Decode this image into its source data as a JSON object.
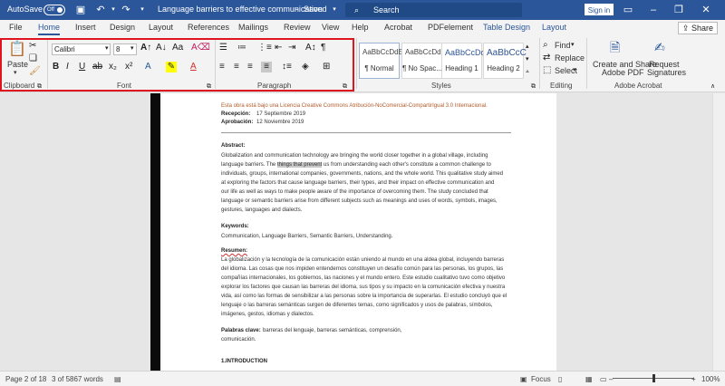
{
  "titlebar": {
    "autosave_label": "AutoSave",
    "autosave_state": "Off",
    "doc_title": "Language barriers to effective communication",
    "saved_state": "Saved",
    "search_placeholder": "Search",
    "signin_label": "Sign in",
    "brand_color": "#2b579a"
  },
  "tabs": [
    {
      "label": "File"
    },
    {
      "label": "Home",
      "active": true
    },
    {
      "label": "Insert"
    },
    {
      "label": "Design"
    },
    {
      "label": "Layout"
    },
    {
      "label": "References"
    },
    {
      "label": "Mailings"
    },
    {
      "label": "Review"
    },
    {
      "label": "View"
    },
    {
      "label": "Help"
    },
    {
      "label": "Acrobat"
    },
    {
      "label": "PDFelement"
    },
    {
      "label": "Table Design",
      "contextual": true
    },
    {
      "label": "Layout",
      "contextual": true
    }
  ],
  "share_label": "Share",
  "ribbon": {
    "clipboard": {
      "paste_label": "Paste",
      "group_label": "Clipboard"
    },
    "font": {
      "font_name": "Calibri",
      "font_size": "8",
      "group_label": "Font"
    },
    "paragraph": {
      "group_label": "Paragraph"
    },
    "styles": {
      "group_label": "Styles",
      "items": [
        {
          "sample": "AaBbCcDdEe",
          "name": "¶ Normal"
        },
        {
          "sample": "AaBbCcDdEe",
          "name": "¶ No Spac..."
        },
        {
          "sample": "AaBbCcDd",
          "name": "Heading 1"
        },
        {
          "sample": "AaBbCcC",
          "name": "Heading 2"
        }
      ]
    },
    "editing": {
      "group_label": "Editing",
      "find": "Find",
      "replace": "Replace",
      "select": "Select"
    },
    "acrobat": {
      "group_label": "Adobe Acrobat",
      "create_share_line1": "Create and Share",
      "create_share_line2": "Adobe PDF",
      "request_line1": "Request",
      "request_line2": "Signatures"
    },
    "highlight_color": "#e0141e"
  },
  "document": {
    "license_line": "Esta obra está bajo una Licencia Creative Commons Atribución-NoComercial-CompartirIgual 3.0 Internacional.",
    "received": "Recepción:",
    "received_date": "17 Septiembre 2019",
    "approved": "Aprobación:",
    "approved_date": "12 Noviembre 2019",
    "abstract_heading": "Abstract:",
    "abstract_lines": [
      "Globalization and communication technology are bringing the world closer together in a global village, including",
      "language barriers. The things that prevent us from understanding each other's constitute a common challenge to",
      "individuals, groups, international companies, governments, nations, and the whole world. This qualitative study aimed",
      "at exploring the factors that cause language barriers, their types, and their impact on effective communication and",
      "our life as well as ways to make people aware of the importance of overcoming them. The study concluded that",
      "language or semantic barriers arise from different subjects such as meanings and uses of words, symbols, images,",
      "gestures, languages and dialects."
    ],
    "keywords_heading": "Keywords:",
    "keywords": "Communication, Language Barriers, Semantic Barriers, Understanding.",
    "resumen_heading": "Resumen:",
    "resumen_lines": [
      "La globalización y la tecnología de la comunicación están uniendo al mundo en una aldea global, incluyendo barreras",
      "del idioma. Las cosas que nos impiden entendernos constituyen un desafío común para las personas, los grupos, las",
      "compañías internacionales, los gobiernos, las naciones y el mundo entero. Este estudio cualitativo tuvo como objetivo",
      "explorar los factores que causan las barreras del idioma, sus tipos y su impacto en la comunicación efectiva y nuestra",
      "vida, así como las formas de sensibilizar a las personas sobre la importancia de superarlas. El estudio concluyó que el",
      "lenguaje o las barreras semánticas surgen de diferentes temas, como significados y usos de palabras, símbolos,",
      "imágenes, gestos, idiomas y dialectos."
    ],
    "palabras_heading": "Palabras clave:",
    "palabras_line1": "barreras del lenguaje, barreras semánticas, comprensión,",
    "palabras_line2": "comunicación.",
    "intro_heading": "1.INTRODUCTION"
  },
  "status": {
    "page": "Page 2 of 18",
    "words": "3 of 5867 words",
    "focus": "Focus",
    "zoom": "100%"
  }
}
